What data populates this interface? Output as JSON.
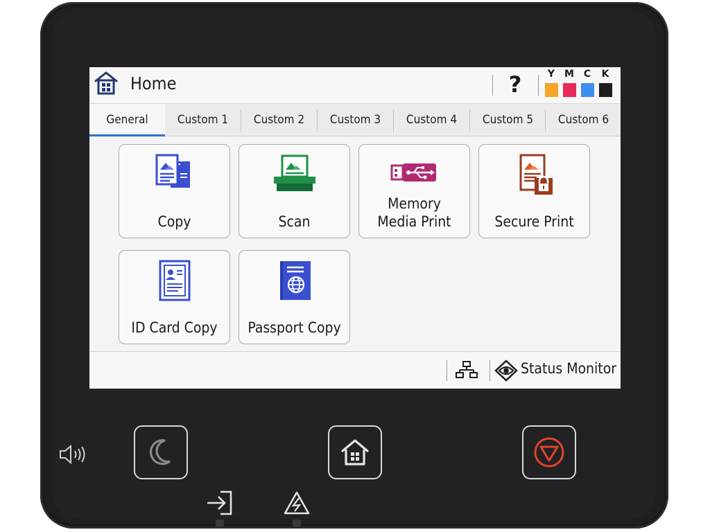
{
  "header": {
    "title": "Home",
    "help_label": "?",
    "inks": [
      {
        "label": "Y",
        "color": "#f5a52a"
      },
      {
        "label": "M",
        "color": "#e62b5a"
      },
      {
        "label": "C",
        "color": "#3d8ff0"
      },
      {
        "label": "K",
        "color": "#1e1e1e"
      }
    ]
  },
  "tabs": [
    {
      "label": "General",
      "active": true
    },
    {
      "label": "Custom 1"
    },
    {
      "label": "Custom 2"
    },
    {
      "label": "Custom 3"
    },
    {
      "label": "Custom 4"
    },
    {
      "label": "Custom 5"
    },
    {
      "label": "Custom 6"
    }
  ],
  "tiles": {
    "copy": {
      "label": "Copy",
      "icon": "copy-icon"
    },
    "scan": {
      "label": "Scan",
      "icon": "scan-icon"
    },
    "memory": {
      "label_line1": "Memory",
      "label_line2": "Media Print",
      "icon": "usb-icon"
    },
    "secure": {
      "label": "Secure Print",
      "icon": "secure-print-icon"
    },
    "idcard": {
      "label": "ID Card Copy",
      "icon": "id-card-icon"
    },
    "passport": {
      "label": "Passport Copy",
      "icon": "passport-icon"
    }
  },
  "footer": {
    "status_label": "Status Monitor",
    "network_icon": "network-icon",
    "eye_icon": "eye-icon"
  },
  "hardware": {
    "sleep_icon": "moon-icon",
    "home_icon": "home-icon",
    "stop_icon": "stop-icon",
    "volume_icon": "speaker-icon",
    "data_icon": "data-arrow-icon",
    "error_icon": "warning-icon"
  },
  "colors": {
    "accent_blue": "#2f6fcf",
    "tile_blue": "#3a4fd0",
    "scan_green": "#1f8f4a",
    "usb_magenta": "#b02a73",
    "secure_brown": "#9b3b1e",
    "stop_red": "#e0442c"
  }
}
